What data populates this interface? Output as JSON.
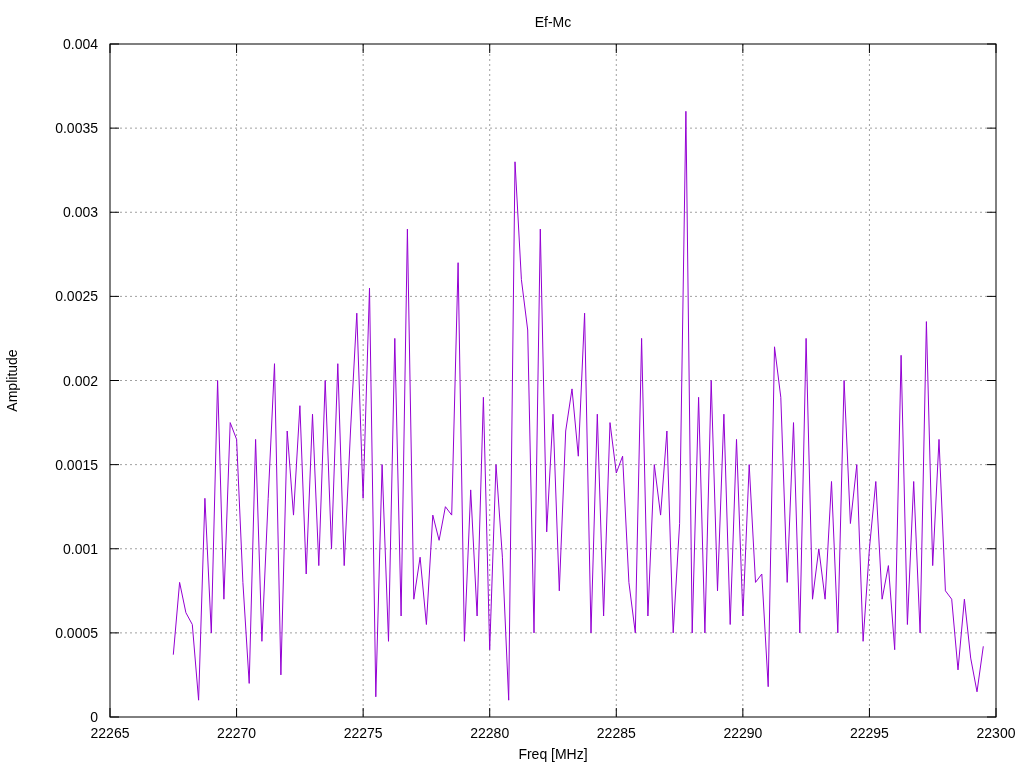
{
  "chart_data": {
    "type": "line",
    "title": "Ef-Mc",
    "xlabel": "Freq [MHz]",
    "ylabel": "Amplitude",
    "xlim": [
      22265,
      22300
    ],
    "ylim": [
      0,
      0.004
    ],
    "xticks": [
      22265,
      22270,
      22275,
      22280,
      22285,
      22290,
      22295,
      22300
    ],
    "yticks": [
      {
        "value": 0,
        "label": "0"
      },
      {
        "value": 0.0005,
        "label": "0.0005"
      },
      {
        "value": 0.001,
        "label": "0.001"
      },
      {
        "value": 0.0015,
        "label": "0.0015"
      },
      {
        "value": 0.002,
        "label": "0.002"
      },
      {
        "value": 0.0025,
        "label": "0.0025"
      },
      {
        "value": 0.003,
        "label": "0.003"
      },
      {
        "value": 0.0035,
        "label": "0.0035"
      },
      {
        "value": 0.004,
        "label": "0.004"
      }
    ],
    "x": [
      22267.5,
      22267.75,
      22268,
      22268.25,
      22268.5,
      22268.75,
      22269,
      22269.25,
      22269.5,
      22269.75,
      22270,
      22270.25,
      22270.5,
      22270.75,
      22271,
      22271.25,
      22271.5,
      22271.75,
      22272,
      22272.25,
      22272.5,
      22272.75,
      22273,
      22273.25,
      22273.5,
      22273.75,
      22274,
      22274.25,
      22274.5,
      22274.75,
      22275,
      22275.25,
      22275.5,
      22275.75,
      22276,
      22276.25,
      22276.5,
      22276.75,
      22277,
      22277.25,
      22277.5,
      22277.75,
      22278,
      22278.25,
      22278.5,
      22278.75,
      22279,
      22279.25,
      22279.5,
      22279.75,
      22280,
      22280.25,
      22280.5,
      22280.75,
      22281,
      22281.25,
      22281.5,
      22281.75,
      22282,
      22282.25,
      22282.5,
      22282.75,
      22283,
      22283.25,
      22283.5,
      22283.75,
      22284,
      22284.25,
      22284.5,
      22284.75,
      22285,
      22285.25,
      22285.5,
      22285.75,
      22286,
      22286.25,
      22286.5,
      22286.75,
      22287,
      22287.25,
      22287.5,
      22287.75,
      22288,
      22288.25,
      22288.5,
      22288.75,
      22289,
      22289.25,
      22289.5,
      22289.75,
      22290,
      22290.25,
      22290.5,
      22290.75,
      22291,
      22291.25,
      22291.5,
      22291.75,
      22292,
      22292.25,
      22292.5,
      22292.75,
      22293,
      22293.25,
      22293.5,
      22293.75,
      22294,
      22294.25,
      22294.5,
      22294.75,
      22295,
      22295.25,
      22295.5,
      22295.75,
      22296,
      22296.25,
      22296.5,
      22296.75,
      22297,
      22297.25,
      22297.5,
      22297.75,
      22298,
      22298.25,
      22298.5,
      22298.75,
      22299,
      22299.25,
      22299.5
    ],
    "grid": true,
    "series": [
      {
        "color": "#9400d3",
        "values": [
          0.00037,
          0.0008,
          0.00062,
          0.00055,
          0.0001,
          0.0013,
          0.0005,
          0.002,
          0.0007,
          0.00175,
          0.00165,
          0.0008,
          0.0002,
          0.00165,
          0.00045,
          0.0013,
          0.0021,
          0.00025,
          0.0017,
          0.0012,
          0.00185,
          0.00085,
          0.0018,
          0.0009,
          0.002,
          0.001,
          0.0021,
          0.0009,
          0.0017,
          0.0024,
          0.0013,
          0.00255,
          0.00012,
          0.0015,
          0.00045,
          0.00225,
          0.0006,
          0.0029,
          0.0007,
          0.00095,
          0.00055,
          0.0012,
          0.00105,
          0.00125,
          0.0012,
          0.0027,
          0.00045,
          0.00135,
          0.0006,
          0.0019,
          0.0004,
          0.0015,
          0.00095,
          0.0001,
          0.0033,
          0.0026,
          0.0023,
          0.0005,
          0.0029,
          0.0011,
          0.0018,
          0.00075,
          0.0017,
          0.00195,
          0.00155,
          0.0024,
          0.0005,
          0.0018,
          0.0006,
          0.00175,
          0.00145,
          0.00155,
          0.0008,
          0.0005,
          0.00225,
          0.0006,
          0.0015,
          0.0012,
          0.0017,
          0.0005,
          0.00115,
          0.0036,
          0.0005,
          0.0019,
          0.0005,
          0.002,
          0.00075,
          0.0018,
          0.00055,
          0.00165,
          0.0006,
          0.0015,
          0.0008,
          0.00085,
          0.00018,
          0.0022,
          0.0019,
          0.0008,
          0.00175,
          0.0005,
          0.00225,
          0.0007,
          0.001,
          0.0007,
          0.0014,
          0.0005,
          0.002,
          0.00115,
          0.0015,
          0.00045,
          0.001,
          0.0014,
          0.0007,
          0.0009,
          0.0004,
          0.00215,
          0.00055,
          0.0014,
          0.0005,
          0.00235,
          0.0009,
          0.00165,
          0.00075,
          0.0007,
          0.00028,
          0.0007,
          0.00035,
          0.00015,
          0.00042
        ]
      }
    ]
  }
}
